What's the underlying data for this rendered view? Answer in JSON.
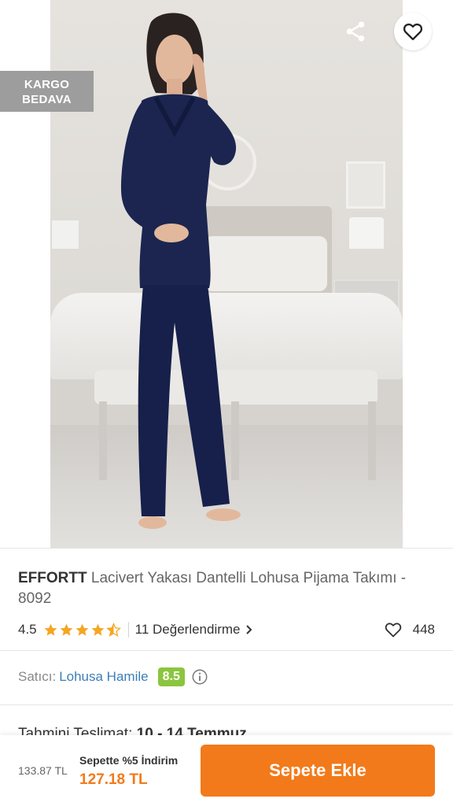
{
  "hero": {
    "badge_line1": "KARGO",
    "badge_line2": "BEDAVA"
  },
  "header": {
    "back_icon": "arrow-left-icon",
    "share_icon": "share-icon",
    "favorite_icon": "heart-outline-icon"
  },
  "product": {
    "brand": "EFFORTT",
    "name": " Lacivert Yakası Dantelli Lohusa Pijama Takımı - 8092",
    "rating": "4.5",
    "rating_stars": 4.5,
    "reviews_label": "11 Değerlendirme",
    "favorites_count": "448"
  },
  "seller": {
    "label": "Satıcı:",
    "name": "Lohusa Hamile",
    "score": "8.5"
  },
  "delivery": {
    "label": "Tahmini Teslimat:",
    "value": "10 - 14 Temmuz"
  },
  "bottom_bar": {
    "old_price": "133.87 TL",
    "discount_label": "Sepette %5 İndirim",
    "new_price": "127.18 TL",
    "add_to_cart_label": "Sepete Ekle"
  },
  "colors": {
    "accent": "#f27a1a",
    "star": "#f5a623",
    "seller_score": "#8bc53f",
    "seller_link": "#3d7eb7"
  }
}
